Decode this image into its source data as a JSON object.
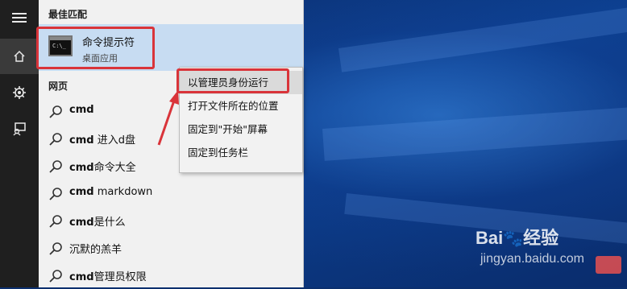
{
  "rail": {
    "items": [
      {
        "icon": "hamburger-menu-icon"
      },
      {
        "icon": "home-icon"
      },
      {
        "icon": "gear-icon"
      },
      {
        "icon": "feedback-icon"
      }
    ]
  },
  "panel": {
    "best_match_heading": "最佳匹配",
    "best_match": {
      "title": "命令提示符",
      "subtitle": "桌面应用",
      "icon": "command-prompt-icon",
      "icon_text": "C:\\_"
    },
    "web_heading": "网页",
    "web_results": [
      {
        "bold": "cmd",
        "rest": ""
      },
      {
        "bold": "cmd",
        "rest": " 进入d盘"
      },
      {
        "bold": "cmd",
        "rest": "命令大全"
      },
      {
        "bold": "cmd",
        "rest": " markdown"
      },
      {
        "bold": "cmd",
        "rest": "是什么"
      },
      {
        "bold": "",
        "rest": "沉默的羔羊"
      },
      {
        "bold": "cmd",
        "rest": "管理员权限"
      }
    ]
  },
  "context_menu": {
    "items": [
      {
        "label": "以管理员身份运行",
        "highlighted": true
      },
      {
        "label": "打开文件所在的位置",
        "highlighted": false
      },
      {
        "label": "固定到\"开始\"屏幕",
        "highlighted": false
      },
      {
        "label": "固定到任务栏",
        "highlighted": false
      }
    ]
  },
  "watermark": {
    "brand": "Bai",
    "brand_cn": "经验",
    "url": "jingyan.baidu.com"
  },
  "colors": {
    "highlight_box": "#d9343a",
    "best_match_bg": "#c7dcf2",
    "rail_bg": "#1f1f1f"
  }
}
